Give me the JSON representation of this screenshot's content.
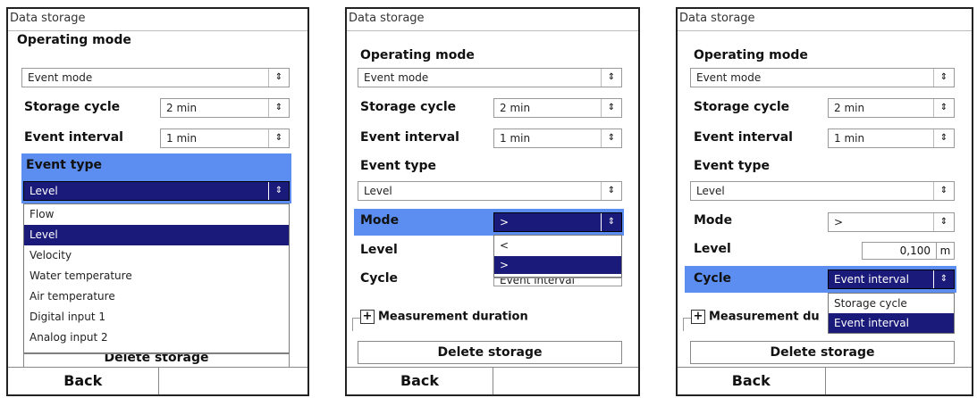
{
  "panel1": {
    "title": "Data storage",
    "operating_mode_label": "Operating mode",
    "operating_mode_value": "Event mode",
    "storage_cycle_label": "Storage cycle",
    "storage_cycle_value": "2 min",
    "event_interval_label": "Event interval",
    "event_interval_value": "1 min",
    "event_type_label": "Event type",
    "event_type_value": "Level",
    "options": [
      "Flow",
      "Level",
      "Velocity",
      "Water temperature",
      "Air temperature",
      "Digital input 1",
      "Analog input 2"
    ],
    "selected_option": "Level",
    "delete_label": "Delete storage",
    "back_label": "Back"
  },
  "panel2": {
    "title": "Data storage",
    "operating_mode_label": "Operating mode",
    "operating_mode_value": "Event mode",
    "storage_cycle_label": "Storage cycle",
    "storage_cycle_value": "2 min",
    "event_interval_label": "Event interval",
    "event_interval_value": "1 min",
    "event_type_label": "Event type",
    "event_type_value": "Level",
    "mode_label": "Mode",
    "mode_value": ">",
    "mode_options": [
      "<",
      ">"
    ],
    "level_label": "Level",
    "cycle_label": "Cycle",
    "cycle_value": "Event interval",
    "measurement_label": "Measurement duration",
    "delete_label": "Delete storage",
    "back_label": "Back"
  },
  "panel3": {
    "title": "Data storage",
    "operating_mode_label": "Operating mode",
    "operating_mode_value": "Event mode",
    "storage_cycle_label": "Storage cycle",
    "storage_cycle_value": "2 min",
    "event_interval_label": "Event interval",
    "event_interval_value": "1 min",
    "event_type_label": "Event type",
    "event_type_value": "Level",
    "mode_label": "Mode",
    "mode_value": ">",
    "level_label": "Level",
    "level_value": "0,100",
    "level_unit": "m",
    "cycle_label": "Cycle",
    "cycle_value": "Event interval",
    "cycle_options": [
      "Storage cycle",
      "Event interval"
    ],
    "measurement_label": "Measurement du",
    "delete_label": "Delete storage",
    "back_label": "Back"
  },
  "icons": {
    "dropdown": "up-down-arrows-icon",
    "expand": "plus-box-icon"
  }
}
